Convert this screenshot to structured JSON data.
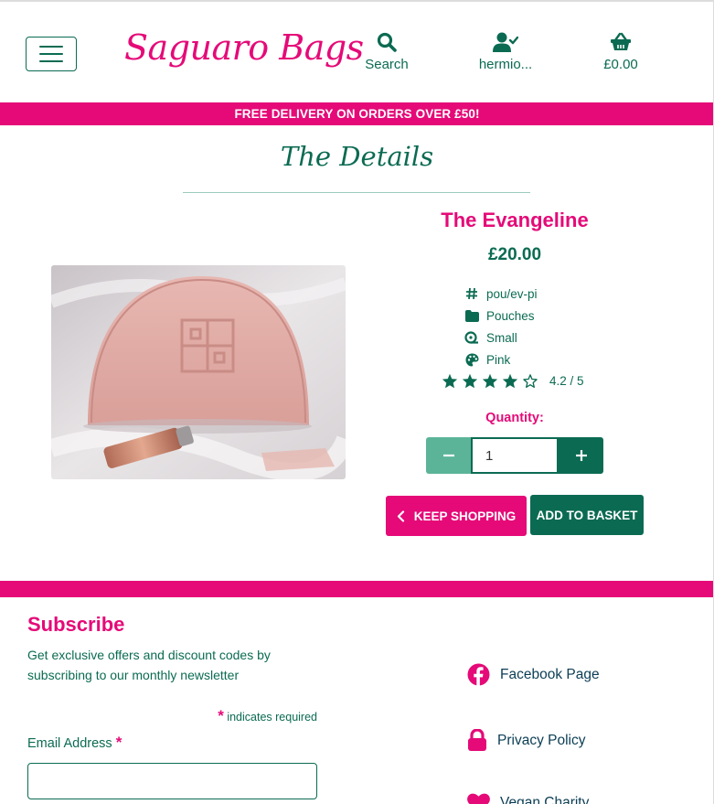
{
  "header": {
    "logo": "Saguaro Bags",
    "search_label": "Search",
    "account_label": "hermio...",
    "basket_total": "£0.00"
  },
  "banner": "FREE DELIVERY ON ORDERS OVER £50!",
  "page_title": "The Details",
  "product": {
    "name": "The Evangeline",
    "price": "£20.00",
    "sku": "pou/ev-pi",
    "category": "Pouches",
    "size": "Small",
    "colour": "Pink",
    "rating": 4.2,
    "rating_text": "4.2 / 5"
  },
  "quantity": {
    "label": "Quantity:",
    "value": "1"
  },
  "buttons": {
    "keep_shopping": "KEEP SHOPPING",
    "add_to_basket": "ADD TO BASKET"
  },
  "subscribe": {
    "title": "Subscribe",
    "text": "Get exclusive offers and discount codes by subscribing to our monthly newsletter",
    "required_note": "indicates required",
    "email_label": "Email Address",
    "email_value": ""
  },
  "footer_links": {
    "facebook": "Facebook Page",
    "privacy": "Privacy Policy",
    "charity": "Vegan Charity"
  },
  "colors": {
    "brand_pink": "#e50a78",
    "brand_green": "#0b6b52",
    "light_green": "#5cb498"
  }
}
